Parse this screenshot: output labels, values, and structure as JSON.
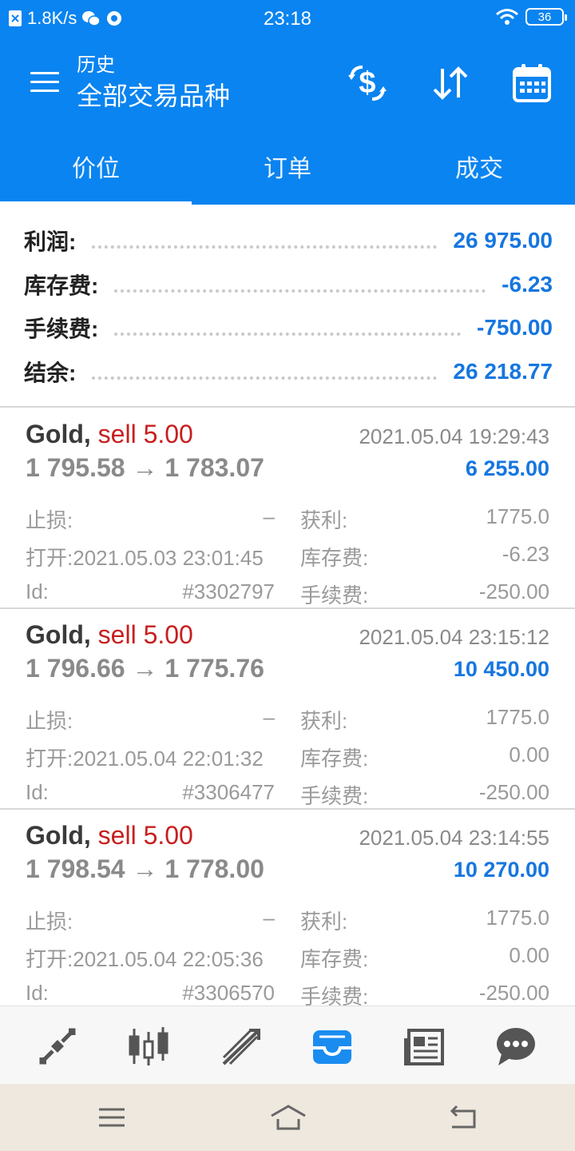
{
  "status_bar": {
    "speed": "1.8K/s",
    "time": "23:18",
    "battery": "36"
  },
  "header": {
    "subtitle": "历史",
    "title": "全部交易品种"
  },
  "tabs": [
    {
      "label": "价位",
      "active": true
    },
    {
      "label": "订单",
      "active": false
    },
    {
      "label": "成交",
      "active": false
    }
  ],
  "summary": {
    "rows": [
      {
        "label": "利润:",
        "value": "26 975.00"
      },
      {
        "label": "库存费:",
        "value": "-6.23"
      },
      {
        "label": "手续费:",
        "value": "-750.00"
      },
      {
        "label": "结余:",
        "value": "26 218.77"
      }
    ]
  },
  "trades": [
    {
      "symbol": "Gold,",
      "action": "sell 5.00",
      "close_time": "2021.05.04 19:29:43",
      "prices": "1 795.58 → 1 783.07",
      "profit": "6 255.00",
      "sl_label": "止损:",
      "sl_value": "–",
      "tp_label": "获利:",
      "tp_value": "1775.0",
      "open_label": "打开:",
      "open_value": "2021.05.03 23:01:45",
      "swap_label": "库存费:",
      "swap_value": "-6.23",
      "id_label": "Id:",
      "id_value": "#3302797",
      "fee_label": "手续费:",
      "fee_value": "-250.00"
    },
    {
      "symbol": "Gold,",
      "action": "sell 5.00",
      "close_time": "2021.05.04 23:15:12",
      "prices": "1 796.66 → 1 775.76",
      "profit": "10 450.00",
      "sl_label": "止损:",
      "sl_value": "–",
      "tp_label": "获利:",
      "tp_value": "1775.0",
      "open_label": "打开:",
      "open_value": "2021.05.04 22:01:32",
      "swap_label": "库存费:",
      "swap_value": "0.00",
      "id_label": "Id:",
      "id_value": "#3306477",
      "fee_label": "手续费:",
      "fee_value": "-250.00"
    },
    {
      "symbol": "Gold,",
      "action": "sell 5.00",
      "close_time": "2021.05.04 23:14:55",
      "prices": "1 798.54 → 1 778.00",
      "profit": "10 270.00",
      "sl_label": "止损:",
      "sl_value": "–",
      "tp_label": "获利:",
      "tp_value": "1775.0",
      "open_label": "打开:",
      "open_value": "2021.05.04 22:05:36",
      "swap_label": "库存费:",
      "swap_value": "0.00",
      "id_label": "Id:",
      "id_value": "#3306570",
      "fee_label": "手续费:",
      "fee_value": "-250.00"
    }
  ],
  "bottom_nav": [
    {
      "icon": "quotes-icon",
      "active": false
    },
    {
      "icon": "chart-icon",
      "active": false
    },
    {
      "icon": "trade-icon",
      "active": false
    },
    {
      "icon": "history-icon",
      "active": true
    },
    {
      "icon": "news-icon",
      "active": false
    },
    {
      "icon": "chat-icon",
      "active": false
    }
  ],
  "system_nav": [
    "menu-icon",
    "home-icon",
    "back-icon"
  ],
  "colors": {
    "primary": "#0a84f0",
    "profit_blue": "#1676e0",
    "sell_red": "#c81e1e",
    "muted_gray": "#9a9a9a"
  }
}
